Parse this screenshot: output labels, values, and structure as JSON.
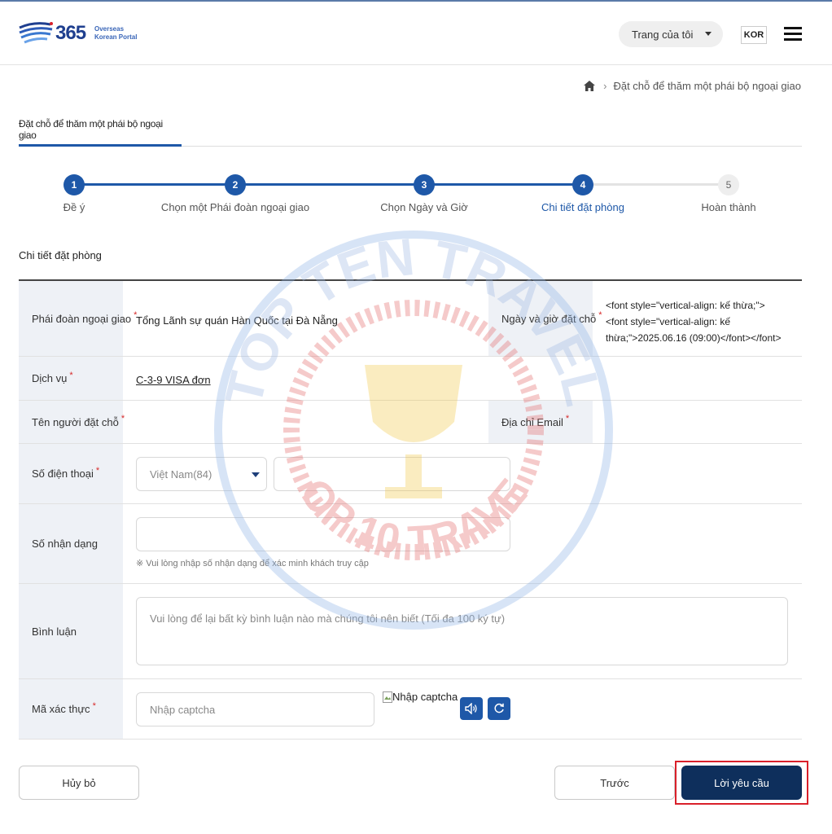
{
  "header": {
    "logo_number": "365",
    "logo_sub_line1": "Overseas",
    "logo_sub_line2": "Korean Portal",
    "my_page_label": "Trang của tôi",
    "language": "KOR"
  },
  "breadcrumb": {
    "current": "Đặt chỗ để thăm một phái bộ ngoại giao"
  },
  "tab": {
    "label": "Đặt chỗ để thăm một phái bộ ngoại giao"
  },
  "stepper": {
    "steps": [
      {
        "number": "1",
        "label": "Đề ý"
      },
      {
        "number": "2",
        "label": "Chọn một Phái đoàn ngoại giao"
      },
      {
        "number": "3",
        "label": "Chọn Ngày và Giờ"
      },
      {
        "number": "4",
        "label": "Chi tiết đặt phòng"
      },
      {
        "number": "5",
        "label": "Hoàn thành"
      }
    ],
    "current_step": 4
  },
  "section_title": "Chi tiết đặt phòng",
  "form": {
    "mission": {
      "label": "Phái đoàn ngoại giao",
      "value": "Tổng Lãnh sự quán Hàn Quốc tại Đà Nẵng"
    },
    "datetime": {
      "label": "Ngày và giờ đặt chỗ",
      "value_line1": "<font style=\"vertical-align: kế thừa;\">",
      "value_line2": "<font style=\"vertical-align: kế",
      "value_line3": "thừa;\">2025.06.16 (09:00)</font></font>"
    },
    "service": {
      "label": "Dịch vụ",
      "value": "C-3-9 VISA đơn"
    },
    "booker_name": {
      "label": "Tên người đặt chỗ",
      "value": ""
    },
    "email": {
      "label": "Địa chỉ Email",
      "value": ""
    },
    "phone": {
      "label": "Số điện thoại",
      "country_selected": "Việt Nam(84)",
      "number_value": ""
    },
    "id_number": {
      "label": "Số nhận dạng",
      "value": "",
      "hint": "※ Vui lòng nhập số nhận dạng để xác minh khách truy cập"
    },
    "comment": {
      "label": "Bình luận",
      "placeholder": "Vui lòng để lại bất kỳ bình luận nào mà chúng tôi nên biết (Tối đa 100 ký tự)"
    },
    "captcha": {
      "label": "Mã xác thực",
      "placeholder": "Nhập captcha",
      "image_alt": "Nhập captcha"
    },
    "required_mark": "*"
  },
  "buttons": {
    "cancel": "Hủy bỏ",
    "previous": "Trước",
    "submit": "Lời yêu cầu"
  },
  "colors": {
    "primary": "#1e58a8",
    "submit_bg": "#0e2f5c",
    "required": "#d62828",
    "label_bg": "#eef1f6",
    "highlight_border": "#d9202a"
  },
  "watermark": {
    "top_text": "TOP TEN TRAVEL",
    "bottom_text": "TOP 10 TRAVEL"
  }
}
